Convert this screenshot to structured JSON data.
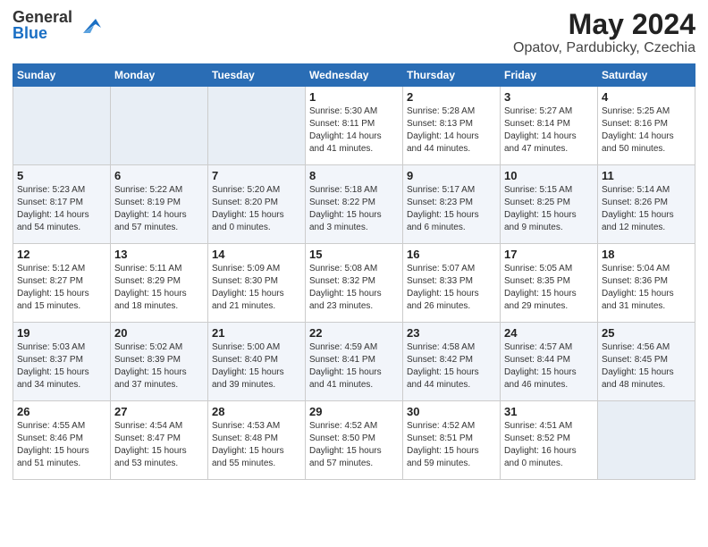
{
  "header": {
    "logo_general": "General",
    "logo_blue": "Blue",
    "month_year": "May 2024",
    "location": "Opatov, Pardubicky, Czechia"
  },
  "weekdays": [
    "Sunday",
    "Monday",
    "Tuesday",
    "Wednesday",
    "Thursday",
    "Friday",
    "Saturday"
  ],
  "weeks": [
    [
      {
        "day": "",
        "detail": ""
      },
      {
        "day": "",
        "detail": ""
      },
      {
        "day": "",
        "detail": ""
      },
      {
        "day": "1",
        "detail": "Sunrise: 5:30 AM\nSunset: 8:11 PM\nDaylight: 14 hours\nand 41 minutes."
      },
      {
        "day": "2",
        "detail": "Sunrise: 5:28 AM\nSunset: 8:13 PM\nDaylight: 14 hours\nand 44 minutes."
      },
      {
        "day": "3",
        "detail": "Sunrise: 5:27 AM\nSunset: 8:14 PM\nDaylight: 14 hours\nand 47 minutes."
      },
      {
        "day": "4",
        "detail": "Sunrise: 5:25 AM\nSunset: 8:16 PM\nDaylight: 14 hours\nand 50 minutes."
      }
    ],
    [
      {
        "day": "5",
        "detail": "Sunrise: 5:23 AM\nSunset: 8:17 PM\nDaylight: 14 hours\nand 54 minutes."
      },
      {
        "day": "6",
        "detail": "Sunrise: 5:22 AM\nSunset: 8:19 PM\nDaylight: 14 hours\nand 57 minutes."
      },
      {
        "day": "7",
        "detail": "Sunrise: 5:20 AM\nSunset: 8:20 PM\nDaylight: 15 hours\nand 0 minutes."
      },
      {
        "day": "8",
        "detail": "Sunrise: 5:18 AM\nSunset: 8:22 PM\nDaylight: 15 hours\nand 3 minutes."
      },
      {
        "day": "9",
        "detail": "Sunrise: 5:17 AM\nSunset: 8:23 PM\nDaylight: 15 hours\nand 6 minutes."
      },
      {
        "day": "10",
        "detail": "Sunrise: 5:15 AM\nSunset: 8:25 PM\nDaylight: 15 hours\nand 9 minutes."
      },
      {
        "day": "11",
        "detail": "Sunrise: 5:14 AM\nSunset: 8:26 PM\nDaylight: 15 hours\nand 12 minutes."
      }
    ],
    [
      {
        "day": "12",
        "detail": "Sunrise: 5:12 AM\nSunset: 8:27 PM\nDaylight: 15 hours\nand 15 minutes."
      },
      {
        "day": "13",
        "detail": "Sunrise: 5:11 AM\nSunset: 8:29 PM\nDaylight: 15 hours\nand 18 minutes."
      },
      {
        "day": "14",
        "detail": "Sunrise: 5:09 AM\nSunset: 8:30 PM\nDaylight: 15 hours\nand 21 minutes."
      },
      {
        "day": "15",
        "detail": "Sunrise: 5:08 AM\nSunset: 8:32 PM\nDaylight: 15 hours\nand 23 minutes."
      },
      {
        "day": "16",
        "detail": "Sunrise: 5:07 AM\nSunset: 8:33 PM\nDaylight: 15 hours\nand 26 minutes."
      },
      {
        "day": "17",
        "detail": "Sunrise: 5:05 AM\nSunset: 8:35 PM\nDaylight: 15 hours\nand 29 minutes."
      },
      {
        "day": "18",
        "detail": "Sunrise: 5:04 AM\nSunset: 8:36 PM\nDaylight: 15 hours\nand 31 minutes."
      }
    ],
    [
      {
        "day": "19",
        "detail": "Sunrise: 5:03 AM\nSunset: 8:37 PM\nDaylight: 15 hours\nand 34 minutes."
      },
      {
        "day": "20",
        "detail": "Sunrise: 5:02 AM\nSunset: 8:39 PM\nDaylight: 15 hours\nand 37 minutes."
      },
      {
        "day": "21",
        "detail": "Sunrise: 5:00 AM\nSunset: 8:40 PM\nDaylight: 15 hours\nand 39 minutes."
      },
      {
        "day": "22",
        "detail": "Sunrise: 4:59 AM\nSunset: 8:41 PM\nDaylight: 15 hours\nand 41 minutes."
      },
      {
        "day": "23",
        "detail": "Sunrise: 4:58 AM\nSunset: 8:42 PM\nDaylight: 15 hours\nand 44 minutes."
      },
      {
        "day": "24",
        "detail": "Sunrise: 4:57 AM\nSunset: 8:44 PM\nDaylight: 15 hours\nand 46 minutes."
      },
      {
        "day": "25",
        "detail": "Sunrise: 4:56 AM\nSunset: 8:45 PM\nDaylight: 15 hours\nand 48 minutes."
      }
    ],
    [
      {
        "day": "26",
        "detail": "Sunrise: 4:55 AM\nSunset: 8:46 PM\nDaylight: 15 hours\nand 51 minutes."
      },
      {
        "day": "27",
        "detail": "Sunrise: 4:54 AM\nSunset: 8:47 PM\nDaylight: 15 hours\nand 53 minutes."
      },
      {
        "day": "28",
        "detail": "Sunrise: 4:53 AM\nSunset: 8:48 PM\nDaylight: 15 hours\nand 55 minutes."
      },
      {
        "day": "29",
        "detail": "Sunrise: 4:52 AM\nSunset: 8:50 PM\nDaylight: 15 hours\nand 57 minutes."
      },
      {
        "day": "30",
        "detail": "Sunrise: 4:52 AM\nSunset: 8:51 PM\nDaylight: 15 hours\nand 59 minutes."
      },
      {
        "day": "31",
        "detail": "Sunrise: 4:51 AM\nSunset: 8:52 PM\nDaylight: 16 hours\nand 0 minutes."
      },
      {
        "day": "",
        "detail": ""
      }
    ]
  ]
}
